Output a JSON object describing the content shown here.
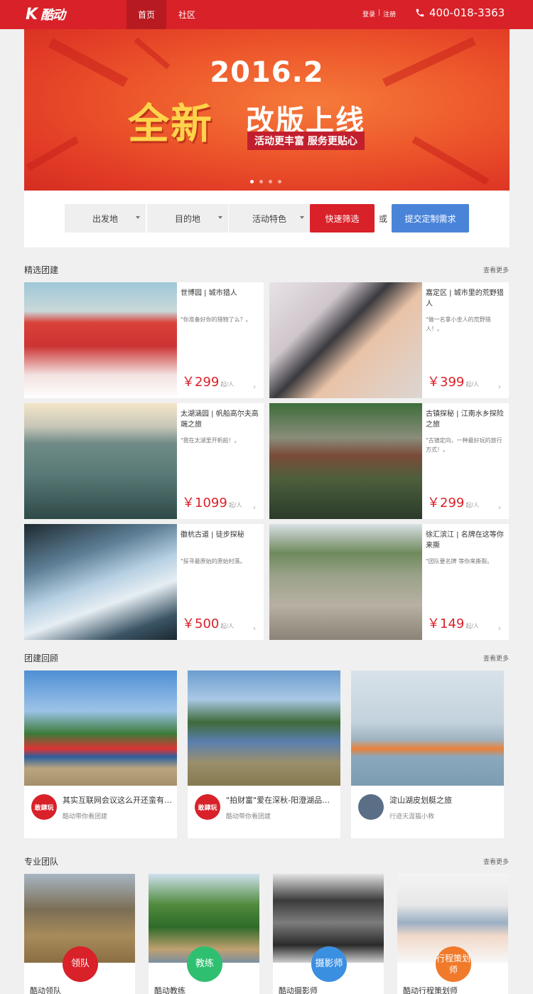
{
  "header": {
    "logo_k": "K",
    "logo_cn": "酷动",
    "nav": [
      {
        "label": "首页",
        "active": true
      },
      {
        "label": "社区",
        "active": false
      }
    ],
    "login": "登录",
    "sep": "|",
    "register": "注册",
    "phone": "400-018-3363",
    "brand_color": "#d92129"
  },
  "banner": {
    "year": "2016.2",
    "headline_new": "全新",
    "headline_online": "改版上线",
    "subline": "活动更丰富 服务更贴心",
    "slide_count": 4,
    "active_slide": 1
  },
  "filter": {
    "departure": "出发地",
    "destination": "目的地",
    "feature": "活动特色",
    "quick_button": "快速筛选",
    "or": "或",
    "custom_button": "提交定制需求"
  },
  "featured": {
    "title": "精选团建",
    "more": "查看更多",
    "items": [
      {
        "title": "世博园 | 城市猎人",
        "desc": "\"你准备好你的猎物了么？。",
        "price": "￥299",
        "unit": "起/人",
        "icon": "photo-team-red-shirts"
      },
      {
        "title": "嘉定区 | 城市里的荒野猎人",
        "desc": "\"做一名拿小金人的荒野猎人！。",
        "price": "￥399",
        "unit": "起/人",
        "icon": "photo-archery"
      },
      {
        "title": "太湖涵园 | 帆船高尔夫高端之旅",
        "desc": "\"我在太湖里开帆船！。",
        "price": "￥1099",
        "unit": "起/人",
        "icon": "photo-marina"
      },
      {
        "title": "古镇探秘 | 江南水乡探险之旅",
        "desc": "\"古镇定向，一种最好玩的旅行方式！。",
        "price": "￥299",
        "unit": "起/人",
        "icon": "photo-ancient-town"
      },
      {
        "title": "徽杭古道 | 徒步探秘",
        "desc": "\"探寻最原始的原始村落。",
        "price": "￥500",
        "unit": "起/人",
        "icon": "photo-mountain-hike"
      },
      {
        "title": "徐汇滨江 | 名牌在这等你来撕",
        "desc": "\"团队要名牌 等你来撕裂。",
        "price": "￥149",
        "unit": "起/人",
        "icon": "photo-riverside-run"
      }
    ]
  },
  "review": {
    "title": "团建回顾",
    "more": "查看更多",
    "items": [
      {
        "title": "其实互联网会议这么开还蛮有趣...",
        "sub": "酷动带你看团建",
        "avatar": "敢肆玩"
      },
      {
        "title": "\"拍财富\"爱在深秋-阳澄湖品蟹之旅",
        "sub": "酷动带你看团建",
        "avatar": "敢肆玩"
      },
      {
        "title": "淀山湖皮划艇之旅",
        "sub": "行迹天涯猫小救",
        "avatar": ""
      }
    ]
  },
  "team": {
    "title": "专业团队",
    "more": "查看更多",
    "items": [
      {
        "badge": "领队",
        "name": "酷动领队",
        "color": "#d92129"
      },
      {
        "badge": "教练",
        "name": "酷动教练",
        "color": "#2fbf71"
      },
      {
        "badge": "摄影师",
        "name": "酷动摄影师",
        "color": "#3b8fe0"
      },
      {
        "badge": "行程策划师",
        "name": "酷动行程策划师",
        "color": "#f07a2a"
      }
    ]
  }
}
